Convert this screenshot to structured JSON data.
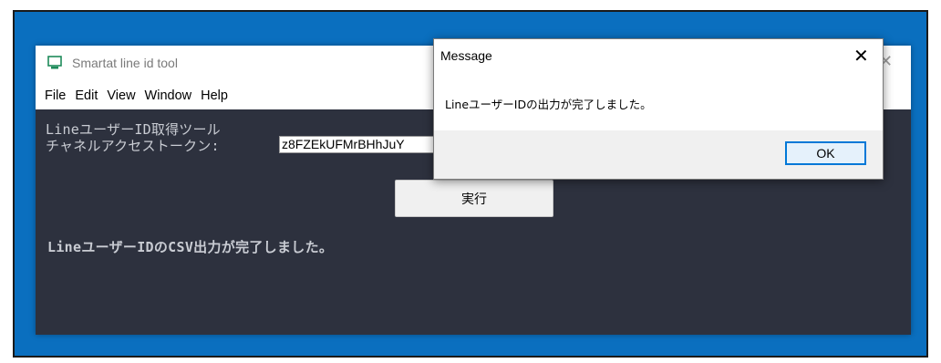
{
  "app_window": {
    "title": "Smartat line id tool",
    "close_glyph": "✕",
    "icon": "monitor-icon",
    "menu": [
      "File",
      "Edit",
      "View",
      "Window",
      "Help"
    ]
  },
  "content": {
    "heading": "LineユーザーID取得ツール",
    "token_label": "チャネルアクセストークン:",
    "token_value": "z8FZEkUFMrBHhJuY",
    "run_button_label": "実行",
    "status_message": "LineユーザーIDのCSV出力が完了しました。"
  },
  "dialog": {
    "title": "Message",
    "close_glyph": "✕",
    "message": "LineユーザーIDの出力が完了しました。",
    "ok_label": "OK"
  },
  "colors": {
    "desktop": "#0a6fbf",
    "content_background": "#2d313e",
    "text_light": "#c9ccd3",
    "focus_accent": "#0078d7"
  }
}
